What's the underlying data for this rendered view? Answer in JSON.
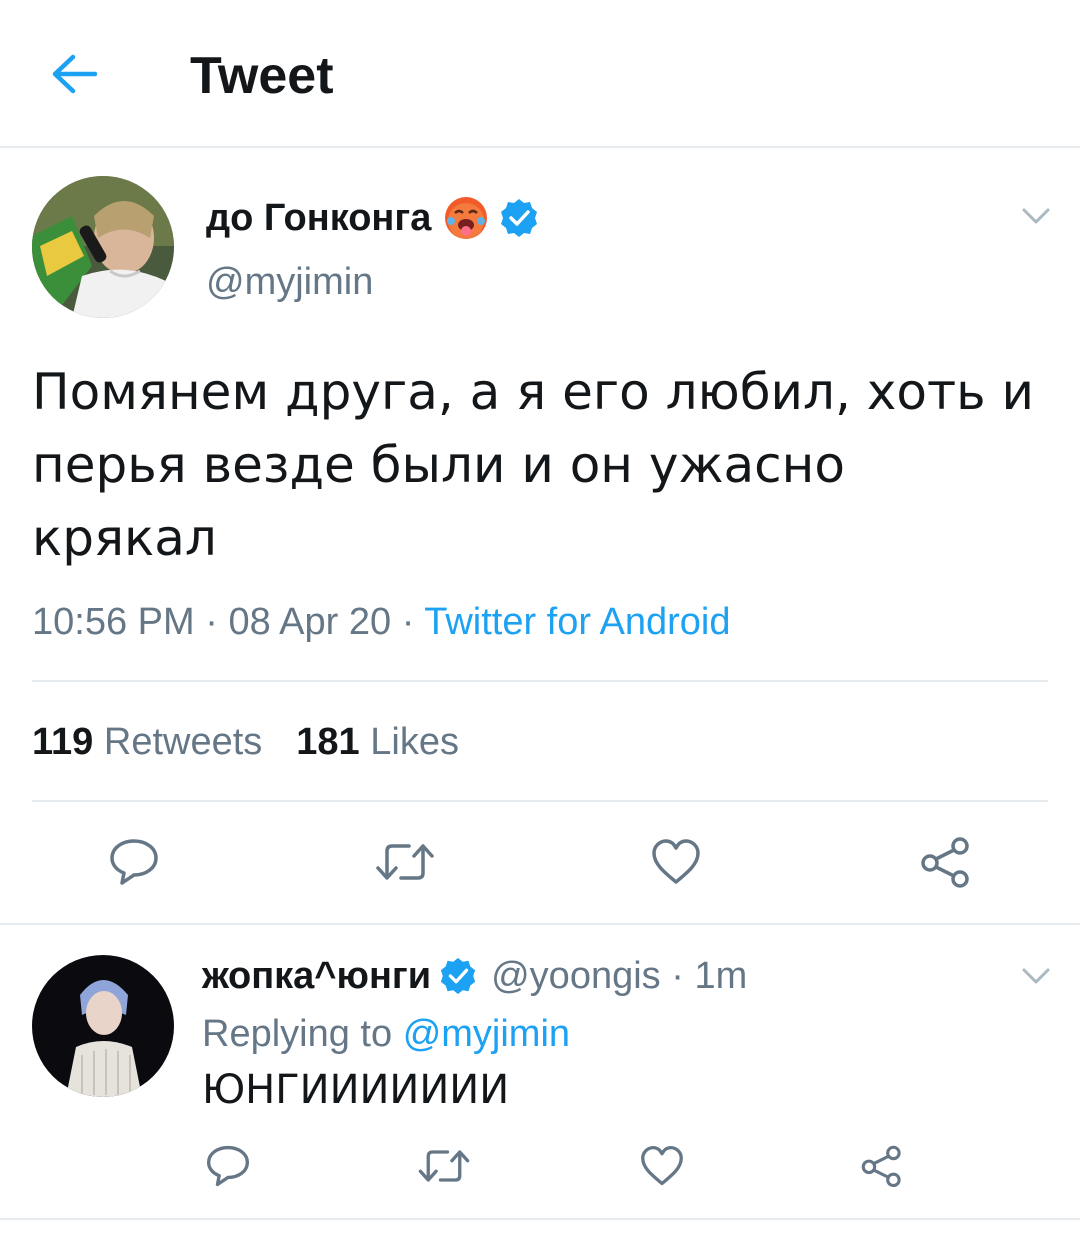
{
  "header": {
    "title": "Tweet"
  },
  "tweet": {
    "display_name": "до Гонконга",
    "handle": "@myjimin",
    "text": "Помянем друга, а я его любил, хоть и перья везде были и он ужасно крякал",
    "time": "10:56 PM",
    "date": "08 Apr 20",
    "source": "Twitter for Android",
    "retweets_count": "119",
    "retweets_label": "Retweets",
    "likes_count": "181",
    "likes_label": "Likes"
  },
  "reply": {
    "display_name": "жопка^юнги",
    "handle": "@yoongis",
    "age": "1m",
    "replying_prefix": "Replying to",
    "replying_to": "@myjimin",
    "text": "ЮНГИИИИИИИ"
  },
  "icons": {
    "back": "arrow-left-icon",
    "chevron": "chevron-down-icon",
    "verified": "verified-badge-icon",
    "emoji": "hot-face-emoji",
    "reply": "reply-icon",
    "retweet": "retweet-icon",
    "like": "heart-icon",
    "share": "share-icon"
  },
  "colors": {
    "accent": "#1da1f2",
    "secondary_text": "#657786",
    "divider": "#e6ecf0",
    "action_icon": "#657786"
  }
}
